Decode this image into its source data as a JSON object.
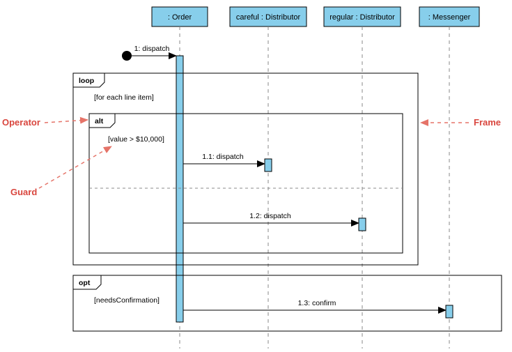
{
  "lifelines": {
    "order": ": Order",
    "careful": "careful : Distributor",
    "regular": "regular : Distributor",
    "messenger": ": Messenger"
  },
  "messages": {
    "m1": "1: dispatch",
    "m11": "1.1: dispatch",
    "m12": "1.2: dispatch",
    "m13": "1.3: confirm"
  },
  "frames": {
    "loop": {
      "op": "loop",
      "guard": "[for each line item]"
    },
    "alt": {
      "op": "alt",
      "guard": "[value > $10,000]"
    },
    "opt": {
      "op": "opt",
      "guard": "[needsConfirmation]"
    }
  },
  "callouts": {
    "operator": "Operator",
    "guard": "Guard",
    "frame": "Frame"
  }
}
